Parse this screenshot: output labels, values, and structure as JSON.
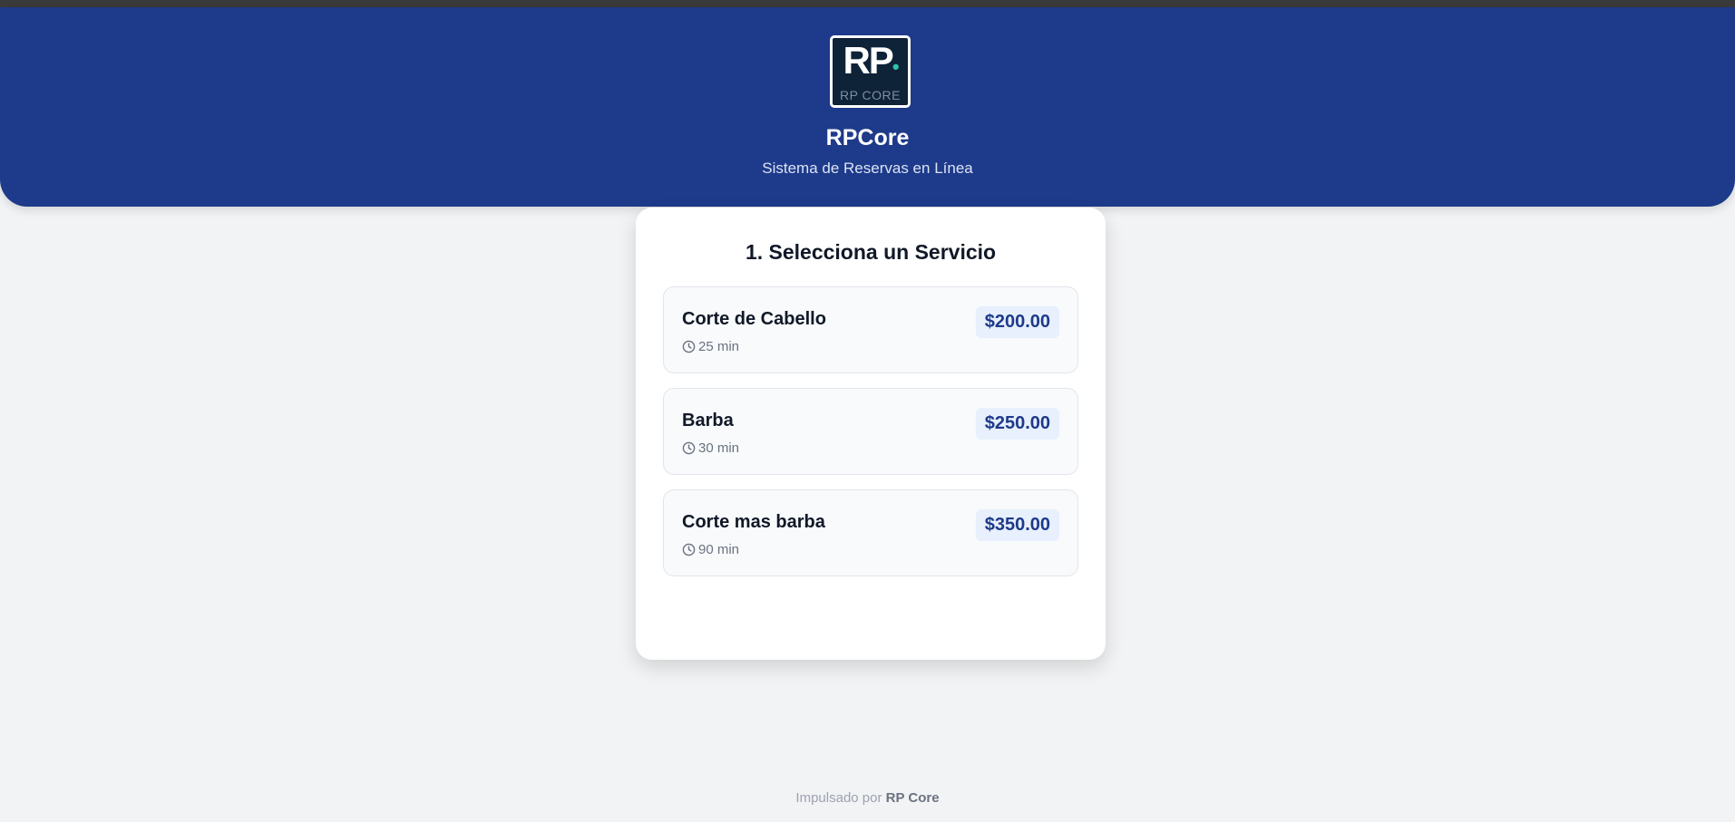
{
  "header": {
    "logo_mark": "RP",
    "logo_sub": "RP CORE",
    "brand": "RPCore",
    "tagline": "Sistema de Reservas en Línea"
  },
  "card": {
    "title": "1. Selecciona un Servicio"
  },
  "services": [
    {
      "name": "Corte de Cabello",
      "duration": "25 min",
      "price": "$200.00",
      "icon": "clock-icon"
    },
    {
      "name": "Barba",
      "duration": "30 min",
      "price": "$250.00",
      "icon": "clock-icon"
    },
    {
      "name": "Corte mas barba",
      "duration": "90 min",
      "price": "$350.00",
      "icon": "clock-icon"
    }
  ],
  "footer": {
    "prefix": "Impulsado por",
    "brand": "RP Core"
  },
  "colors": {
    "header_bg": "#1e3a8a",
    "page_bg": "#f2f3f5",
    "price_text": "#1e3a8a",
    "price_bg": "#e8f0fd"
  }
}
